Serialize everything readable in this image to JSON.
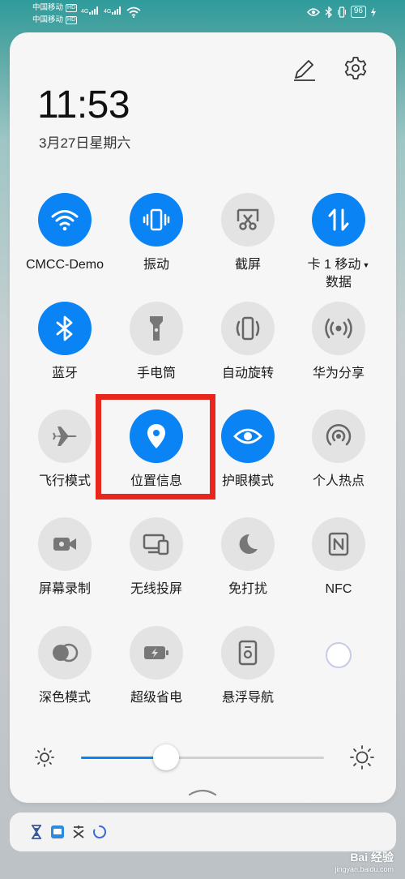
{
  "status_bar": {
    "carrier1": "中国移动",
    "carrier2": "中国移动",
    "hd": "HD",
    "network1": "4G",
    "network2": "4G",
    "battery": "96"
  },
  "header": {
    "time": "11:53",
    "date": "3月27日星期六"
  },
  "tiles": [
    {
      "label": "CMCC-Demo",
      "icon": "wifi-icon",
      "on": true
    },
    {
      "label": "振动",
      "icon": "vibrate-icon",
      "on": true
    },
    {
      "label": "截屏",
      "icon": "screenshot-icon",
      "on": false
    },
    {
      "label": "卡 1 移动",
      "label2": "数据",
      "icon": "mobile-data-icon",
      "on": true
    },
    {
      "label": "蓝牙",
      "icon": "bluetooth-icon",
      "on": true
    },
    {
      "label": "手电筒",
      "icon": "flashlight-icon",
      "on": false
    },
    {
      "label": "自动旋转",
      "icon": "auto-rotate-icon",
      "on": false
    },
    {
      "label": "华为分享",
      "icon": "huawei-share-icon",
      "on": false
    },
    {
      "label": "飞行模式",
      "icon": "airplane-icon",
      "on": false
    },
    {
      "label": "位置信息",
      "icon": "location-icon",
      "on": true
    },
    {
      "label": "护眼模式",
      "icon": "eye-comfort-icon",
      "on": true
    },
    {
      "label": "个人热点",
      "icon": "hotspot-icon",
      "on": false
    },
    {
      "label": "屏幕录制",
      "icon": "screen-record-icon",
      "on": false
    },
    {
      "label": "无线投屏",
      "icon": "wireless-projection-icon",
      "on": false
    },
    {
      "label": "免打扰",
      "icon": "do-not-disturb-icon",
      "on": false
    },
    {
      "label": "NFC",
      "icon": "nfc-icon",
      "on": false
    },
    {
      "label": "深色模式",
      "icon": "dark-mode-icon",
      "on": false
    },
    {
      "label": "超级省电",
      "icon": "power-saving-icon",
      "on": false
    },
    {
      "label": "悬浮导航",
      "icon": "floating-nav-icon",
      "on": false
    }
  ],
  "brightness": {
    "level": 0.35
  },
  "colors": {
    "accent": "#0a84f5",
    "highlight": "#e8261d",
    "tile_off": "#e3e3e3"
  },
  "watermark": {
    "brand": "Bai 经验",
    "domain": "jingyan.baidu.com"
  }
}
